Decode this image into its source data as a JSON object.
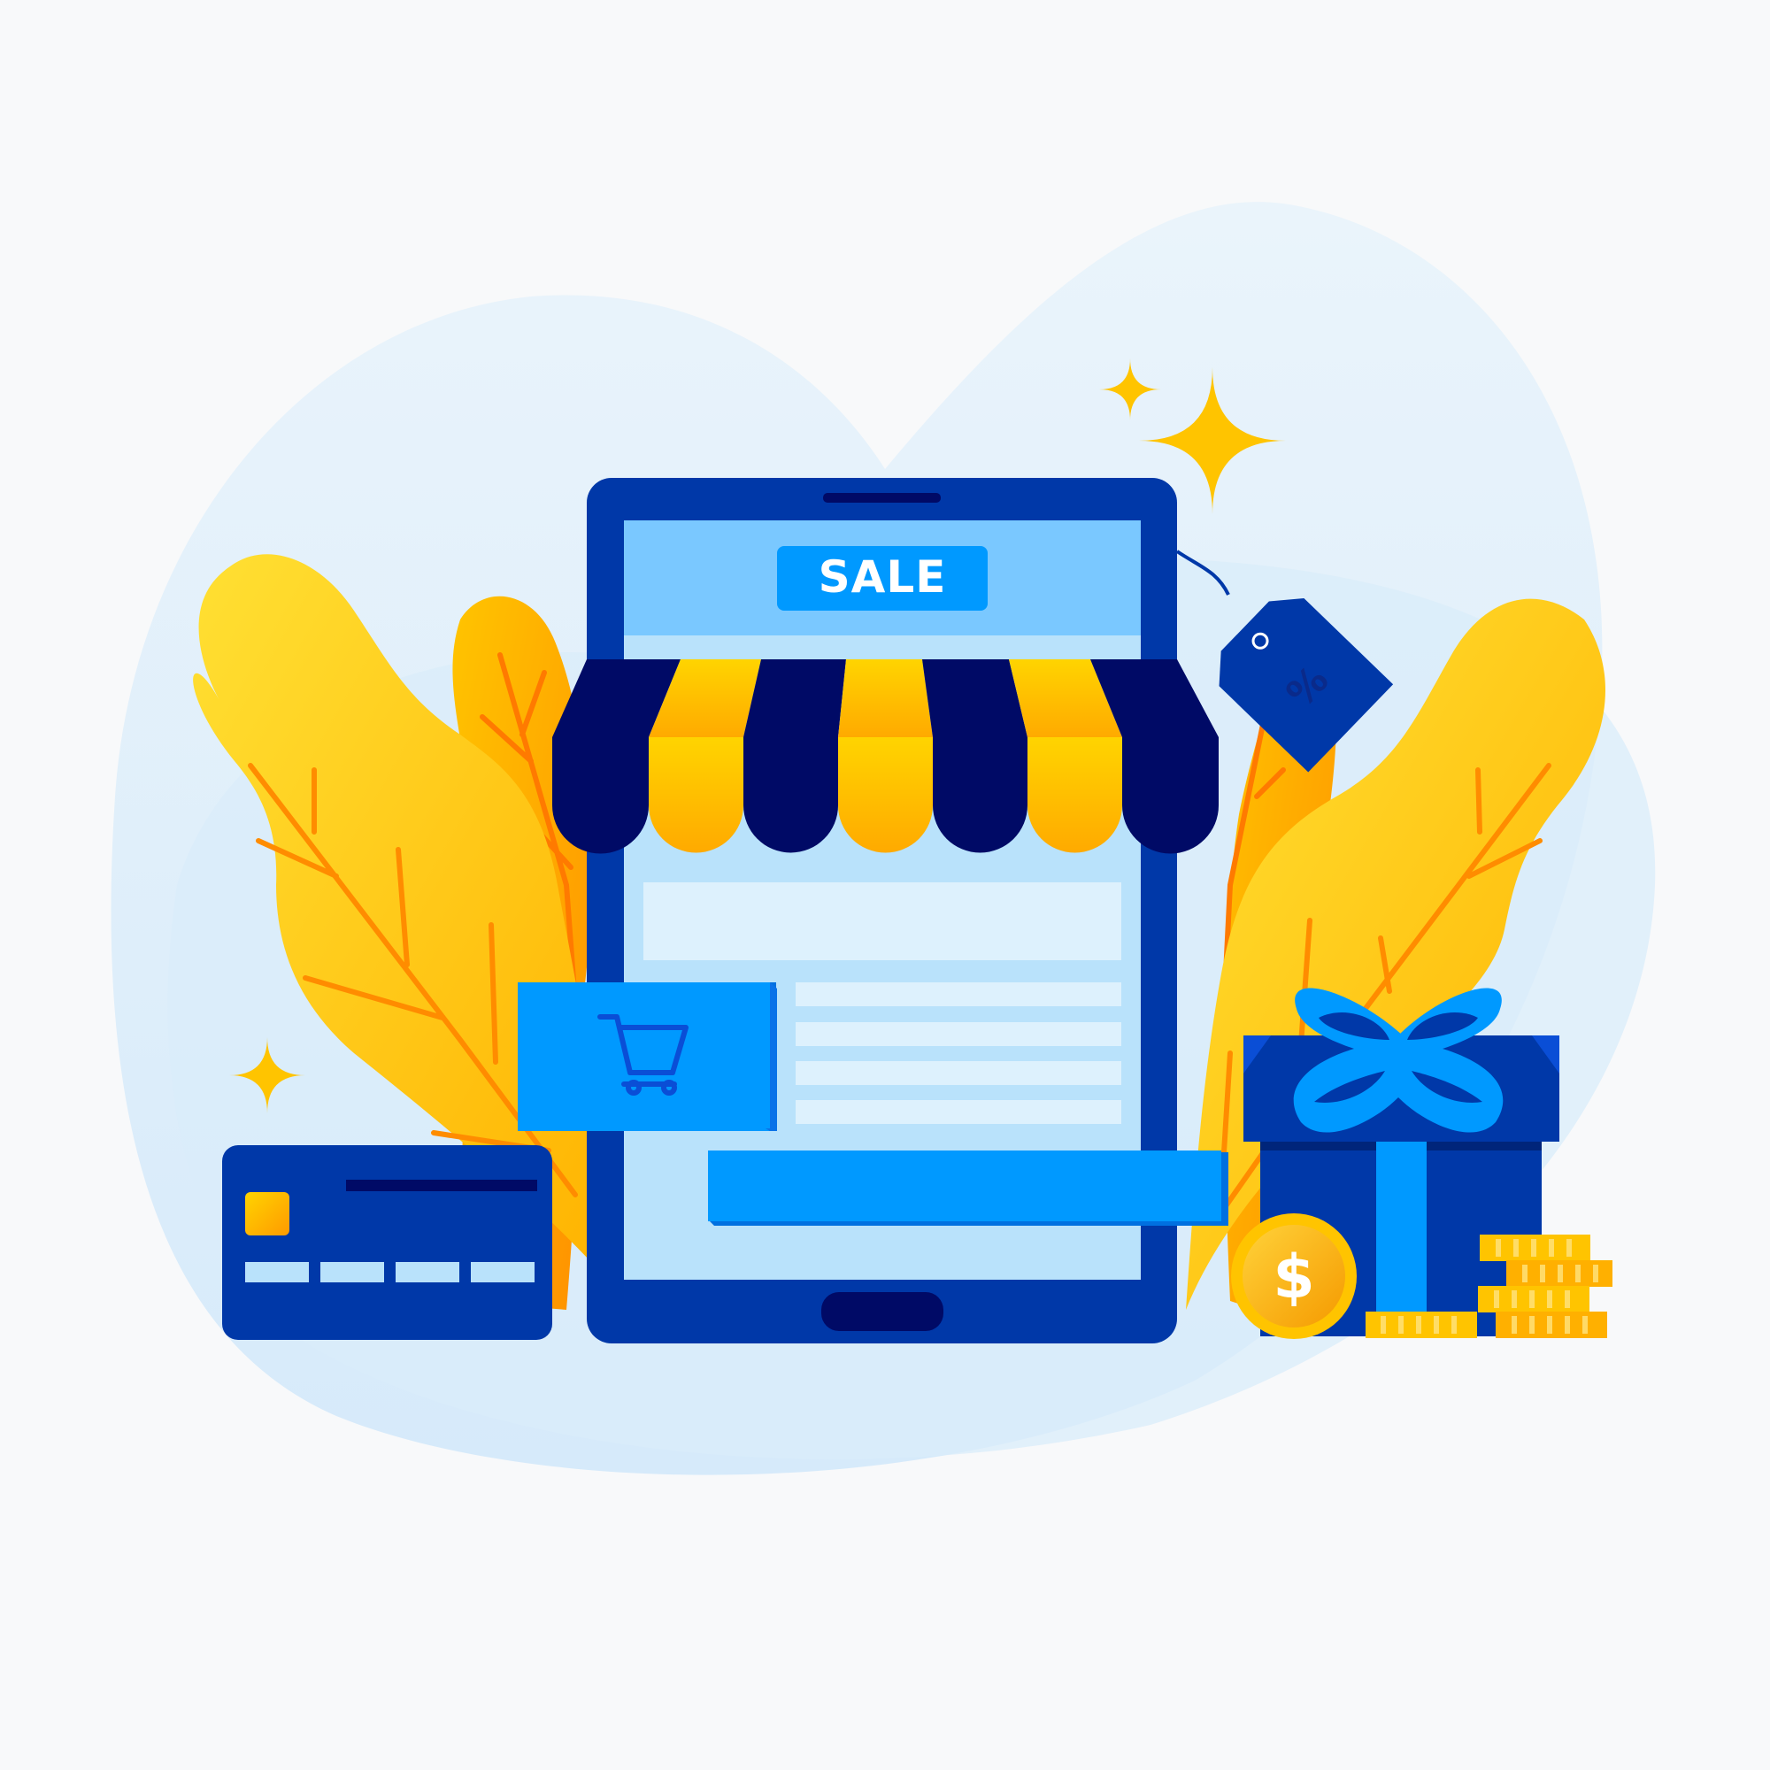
{
  "illustration": {
    "sale_label": "SALE",
    "price_tag_symbol": "%",
    "coin_symbol": "$",
    "icons": [
      "smartphone-icon",
      "shop-awning-icon",
      "shopping-cart-icon",
      "price-tag-icon",
      "credit-card-icon",
      "gift-box-icon",
      "dollar-coin-icon",
      "coin-stack-icon",
      "sparkle-icon",
      "leaf-icon"
    ]
  },
  "colors": {
    "background": "#f8f9fa",
    "blob": "#d9ecfa",
    "phone_frame": "#0038a8",
    "phone_dark": "#000a66",
    "screen_top": "#7ac8ff",
    "screen_body": "#b9e2fb",
    "bright_blue": "#0099ff",
    "yellow": "#ffc200",
    "orange": "#ff9d00"
  }
}
